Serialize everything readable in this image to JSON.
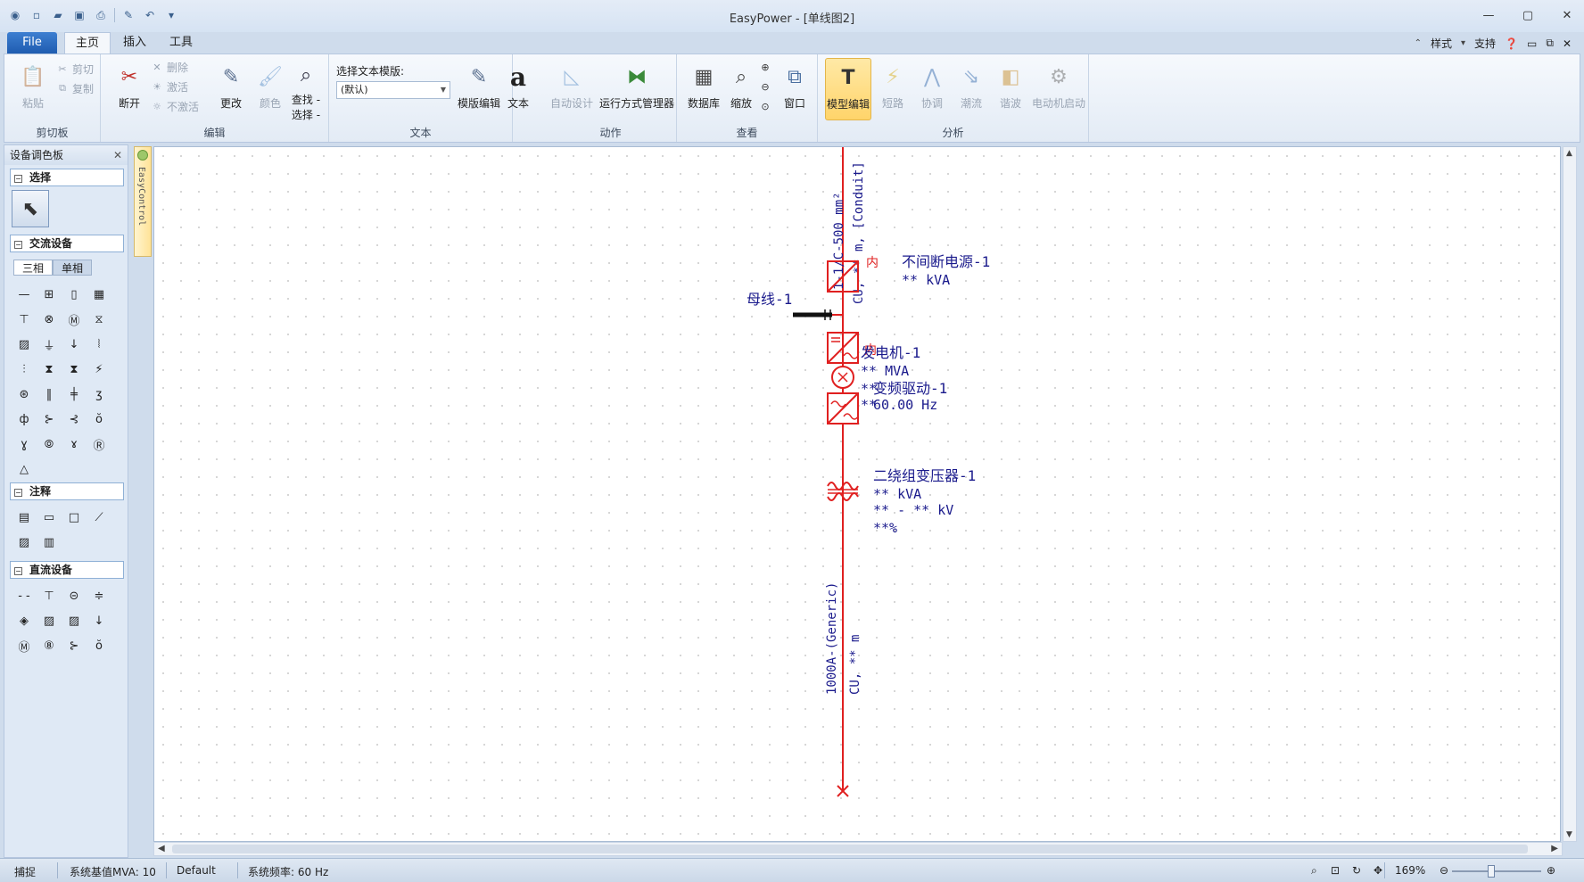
{
  "window": {
    "title": "EasyPower - [单线图2]"
  },
  "tabs": {
    "file": "File",
    "home": "主页",
    "insert": "插入",
    "tools": "工具"
  },
  "tabs_right": {
    "style": "样式",
    "support": "支持"
  },
  "ribbon": {
    "clipboard": {
      "label": "剪切板",
      "paste": "粘贴",
      "cut": "剪切",
      "copy": "复制"
    },
    "edit": {
      "label": "编辑",
      "break": "断开",
      "delete": "删除",
      "activate": "激活",
      "deactivate": "不激活",
      "change": "更改",
      "color": "颜色",
      "find1": "查找 -",
      "find2": "选择 -"
    },
    "text": {
      "label": "文本",
      "template_label": "选择文本模版:",
      "template_value": "(默认)",
      "template_edit": "模版编辑",
      "text_btn": "文本"
    },
    "action": {
      "label": "动作",
      "auto_design": "自动设计",
      "scenario_mgr": "运行方式管理器"
    },
    "view": {
      "label": "查看",
      "database": "数据库",
      "zoom": "缩放",
      "window": "窗口"
    },
    "analysis": {
      "label": "分析",
      "model_edit": "模型编辑",
      "short_circuit": "短路",
      "coordination": "协调",
      "power_flow": "潮流",
      "harmonics": "谐波",
      "motor_start": "电动机启动"
    }
  },
  "palette": {
    "title": "设备调色板",
    "sections": {
      "select": "选择",
      "ac": "交流设备",
      "annotation": "注释",
      "dc": "直流设备"
    },
    "subtabs": {
      "three_phase": "三相",
      "single_phase": "单相"
    },
    "ac_icons": [
      "—",
      "⊞",
      "▯",
      "▦",
      "⊤",
      "⊗",
      "Ⓜ",
      "⧖",
      "▨",
      "⏚",
      "↓",
      "⦚",
      "⫶",
      "⧗",
      "⧗",
      "⚡",
      "⊛",
      "‖",
      "╪",
      "ʒ",
      "ф",
      "⊱",
      "⊰",
      "ŏ",
      "ɣ",
      "⦾",
      "ɤ",
      "Ⓡ",
      "△"
    ],
    "annotation_icons": [
      "▤",
      "▭",
      "□",
      "⟋",
      "▨",
      "▥"
    ],
    "dc_icons": [
      "- -",
      "⊤",
      "⊝",
      "≑",
      "◈",
      "▨",
      "▨",
      "↓",
      "Ⓜ",
      "⑧",
      "⊱",
      "ŏ"
    ]
  },
  "side_tab": {
    "label": "EasyControl"
  },
  "diagram": {
    "cable_top_1": "[Conduit]",
    "cable_top_2": "1-1/C-500 mm²",
    "cable_top_3": "CU, ** m,",
    "ups_tag": "内",
    "ups_name": "不间断电源-1",
    "ups_rating": "** kVA",
    "bus_name": "母线-1",
    "gen_name": "发电机-1",
    "gen_rating": "** MVA",
    "gen_overlap": "内",
    "vfd_name": "变频驱动-1",
    "vfd_overlap": "**",
    "vfd_freq": "60.00 Hz",
    "vfd_overlap2": "**",
    "xfmr_name": "二绕组变压器-1",
    "xfmr_kva": "** kVA",
    "xfmr_kv": "** - ** kV",
    "xfmr_pct": "**%",
    "cable_bot_1": "1000A-(Generic)",
    "cable_bot_2": "CU, ** m"
  },
  "status": {
    "snap": "捕捉",
    "base_mva": "系统基值MVA: 10",
    "default": "Default",
    "freq": "系统频率: 60 Hz",
    "zoom": "169%"
  },
  "colors": {
    "accent": "#1f5cb0",
    "element": "#e02020",
    "label": "#1a1a8c"
  }
}
